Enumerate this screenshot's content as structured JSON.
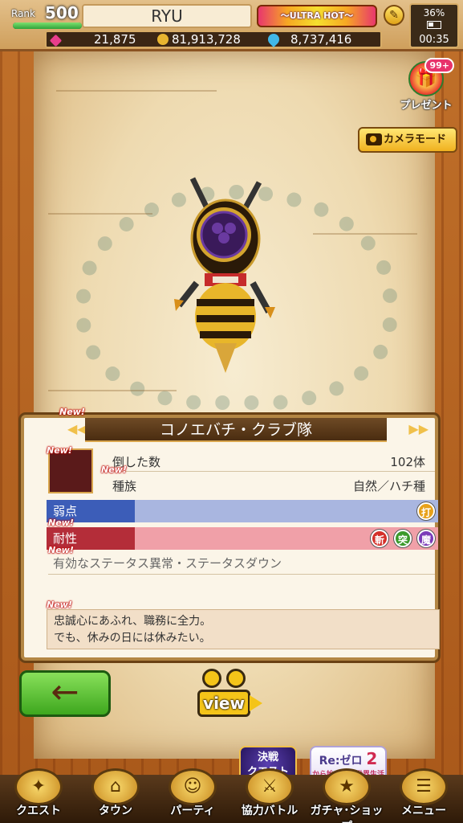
{
  "header": {
    "rank_label": "Rank",
    "rank_value": "500",
    "rank_progress": 1.0,
    "player_name": "RYU",
    "banner_text": "〜ULTRA HOT〜",
    "gems": "21,875",
    "gold": "81,913,728",
    "water": "8,737,416",
    "battery": "36%",
    "time": "00:35"
  },
  "side_buttons": {
    "present_badge": "99+",
    "present_label": "プレゼント",
    "camera_label": "カメラモード"
  },
  "monster": {
    "name": "コノエバチ・クラブ隊",
    "new_tag": "New!",
    "defeated_label": "倒した数",
    "defeated_value": "102体",
    "species_label": "種族",
    "species_value": "自然／ハチ種",
    "weakness_label": "弱点",
    "weakness_elements": [
      "打"
    ],
    "resist_label": "耐性",
    "resist_elements": [
      "斬",
      "突",
      "魔"
    ],
    "status_label": "有効なステータス異常・ステータスダウン",
    "description_line1": "忠誠心にあふれ、職務に全力。",
    "description_line2": "でも、休みの日には休みたい。"
  },
  "buttons": {
    "back_arrow": "←",
    "view_label": "view"
  },
  "promos": {
    "promo1_line1": "決戦",
    "promo1_line2": "クエスト",
    "promo2_title": "Re:ゼロ",
    "promo2_sub": "から始める異世界生活",
    "promo2_num": "2"
  },
  "nav": [
    {
      "label": "クエスト",
      "icon": "quest-icon"
    },
    {
      "label": "タウン",
      "icon": "town-icon"
    },
    {
      "label": "パーティ",
      "icon": "party-icon"
    },
    {
      "label": "協力バトル",
      "icon": "coop-battle-icon"
    },
    {
      "label": "ガチャ･ショップ",
      "icon": "gacha-shop-icon"
    },
    {
      "label": "メニュー",
      "icon": "menu-icon"
    }
  ],
  "colors": {
    "weakness": "#3c5db8",
    "resist": "#b42d39",
    "elem_blunt": "#e7a11a",
    "elem_slash": "#d4302a",
    "elem_pierce": "#3b9a2b",
    "elem_magic": "#7b3bb8"
  }
}
